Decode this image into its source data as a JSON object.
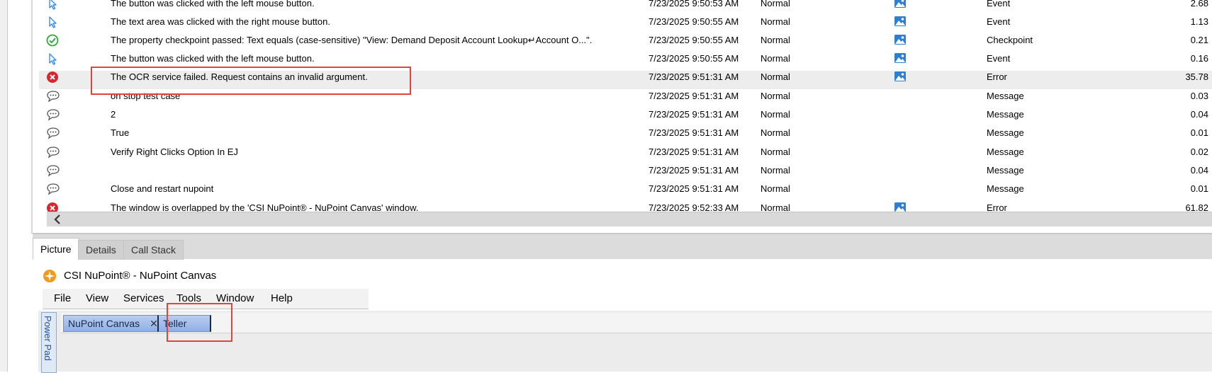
{
  "log": {
    "rows": [
      {
        "icon": "cursor",
        "message": "The button was clicked with the left mouse button.",
        "time": "7/23/2025 9:50:53 AM",
        "level": "Normal",
        "has_picture": true,
        "type": "Event",
        "duration": "2.68"
      },
      {
        "icon": "cursor",
        "message": "The text area was clicked with the right mouse button.",
        "time": "7/23/2025 9:50:55 AM",
        "level": "Normal",
        "has_picture": true,
        "type": "Event",
        "duration": "1.13"
      },
      {
        "icon": "check",
        "message": "The property checkpoint passed: Text equals (case-sensitive) \"View: Demand Deposit Account Lookup↵Account O...\".",
        "time": "7/23/2025 9:50:55 AM",
        "level": "Normal",
        "has_picture": true,
        "type": "Checkpoint",
        "duration": "0.21"
      },
      {
        "icon": "cursor",
        "message": "The button was clicked with the left mouse button.",
        "time": "7/23/2025 9:50:55 AM",
        "level": "Normal",
        "has_picture": true,
        "type": "Event",
        "duration": "0.16"
      },
      {
        "icon": "error",
        "message": "The OCR service failed. Request contains an invalid argument.",
        "time": "7/23/2025 9:51:31 AM",
        "level": "Normal",
        "has_picture": true,
        "type": "Error",
        "duration": "35.78",
        "selected": true
      },
      {
        "icon": "message",
        "message": "on stop test case",
        "time": "7/23/2025 9:51:31 AM",
        "level": "Normal",
        "has_picture": false,
        "type": "Message",
        "duration": "0.03"
      },
      {
        "icon": "message",
        "message": "2",
        "time": "7/23/2025 9:51:31 AM",
        "level": "Normal",
        "has_picture": false,
        "type": "Message",
        "duration": "0.04"
      },
      {
        "icon": "message",
        "message": "True",
        "time": "7/23/2025 9:51:31 AM",
        "level": "Normal",
        "has_picture": false,
        "type": "Message",
        "duration": "0.01"
      },
      {
        "icon": "message",
        "message": "Verify Right Clicks Option In EJ",
        "time": "7/23/2025 9:51:31 AM",
        "level": "Normal",
        "has_picture": false,
        "type": "Message",
        "duration": "0.02"
      },
      {
        "icon": "message",
        "message": "",
        "time": "7/23/2025 9:51:31 AM",
        "level": "Normal",
        "has_picture": false,
        "type": "Message",
        "duration": "0.04"
      },
      {
        "icon": "message",
        "message": "Close and restart nupoint",
        "time": "7/23/2025 9:51:31 AM",
        "level": "Normal",
        "has_picture": false,
        "type": "Message",
        "duration": "0.01"
      },
      {
        "icon": "error",
        "message": "The window is overlapped by the 'CSI NuPoint® - NuPoint Canvas' window.",
        "time": "7/23/2025 9:52:33 AM",
        "level": "Normal",
        "has_picture": true,
        "type": "Error",
        "duration": "61.82"
      }
    ]
  },
  "panel_tabs": {
    "picture": "Picture",
    "details": "Details",
    "call_stack": "Call Stack"
  },
  "app": {
    "title": "CSI NuPoint® - NuPoint Canvas",
    "menu": {
      "file": "File",
      "view": "View",
      "services": "Services",
      "tools": "Tools",
      "window": "Window",
      "help": "Help"
    },
    "power_pad": "Power Pad",
    "doc_tabs": {
      "canvas": "NuPoint Canvas",
      "close_glyph": "✕",
      "teller": "Teller"
    }
  },
  "colors": {
    "highlight": "#e2443c",
    "selected_row": "#ededed",
    "cursor_icon": "#3a8ee6",
    "check_icon": "#2eaa3a",
    "error_icon": "#d9262e",
    "picture_icon": "#2f7fd1"
  }
}
